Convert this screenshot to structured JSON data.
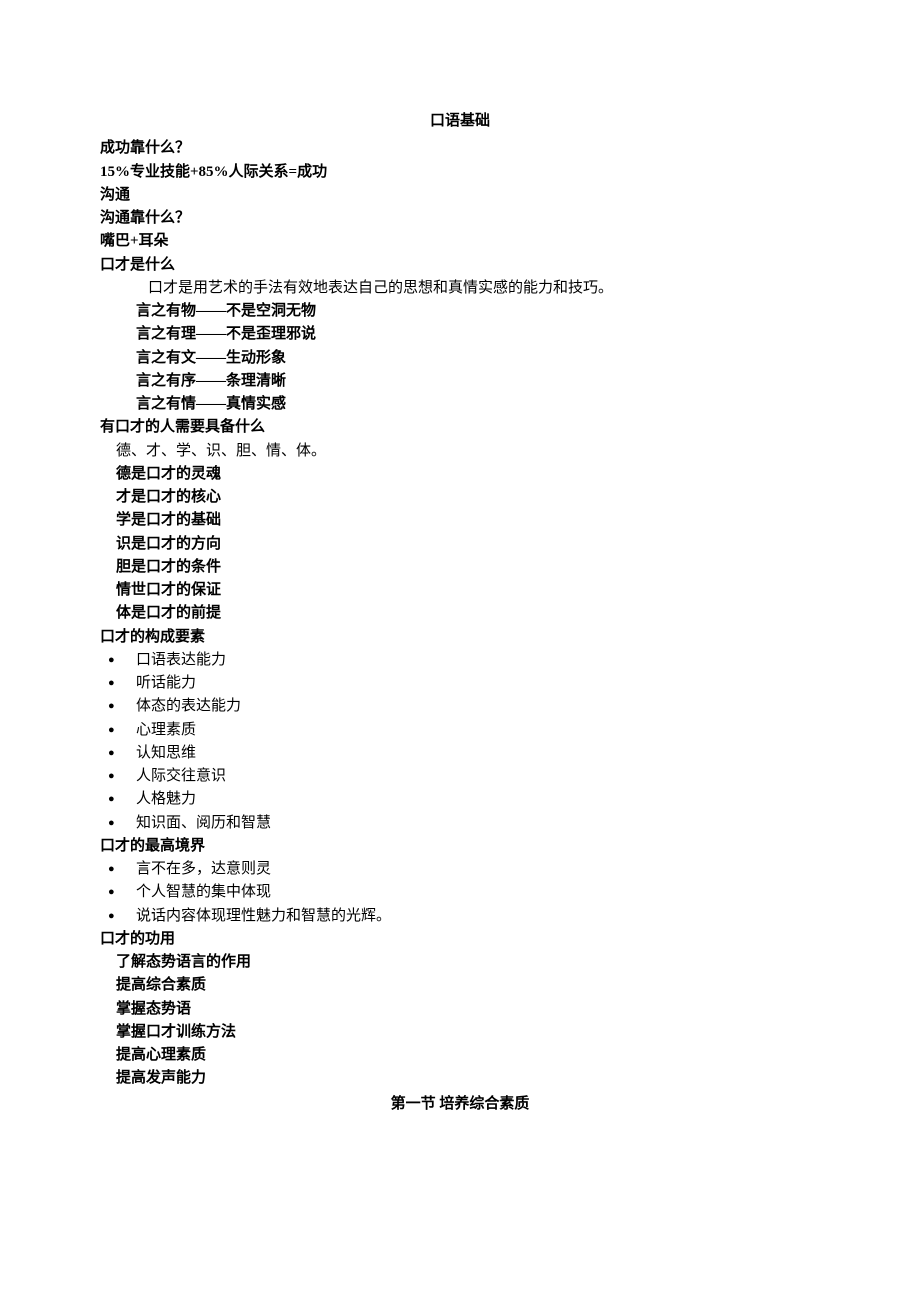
{
  "title": "口语基础",
  "q1": "成功靠什么？",
  "formula": "15%专业技能+85%人际关系=成功",
  "goutong": " 沟通",
  "q2": "沟通靠什么？",
  "mouthEar": "嘴巴+耳朵",
  "q3": "口才是什么",
  "q3_desc": "口才是用艺术的手法有效地表达自己的思想和真情实感的能力和技巧。",
  "yan": [
    "言之有物——不是空洞无物",
    "言之有理——不是歪理邪说",
    "言之有文——生动形象",
    "言之有序——条理清晰",
    "言之有情——真情实感"
  ],
  "q4": "有口才的人需要具备什么",
  "q4_desc": "德、才、学、识、胆、情、体。",
  "de_items": [
    "德是口才的灵魂",
    "才是口才的核心",
    "学是口才的基础",
    "识是口才的方向",
    "胆是口才的条件",
    "情世口才的保证",
    "体是口才的前提"
  ],
  "q5": "口才的构成要素",
  "yaosu": [
    "口语表达能力",
    "听话能力",
    "体态的表达能力",
    "心理素质",
    "认知思维",
    "人际交往意识",
    "人格魅力",
    "知识面、阅历和智慧"
  ],
  "q6": "口才的最高境界",
  "jingjie": [
    "言不在多，达意则灵",
    "个人智慧的集中体现",
    "说话内容体现理性魅力和智慧的光辉。"
  ],
  "q7": "口才的功用",
  "gongyong": [
    "了解态势语言的作用",
    "提高综合素质",
    "掌握态势语",
    "掌握口才训练方法",
    "提高心理素质",
    "提高发声能力"
  ],
  "section1": "第一节  培养综合素质"
}
